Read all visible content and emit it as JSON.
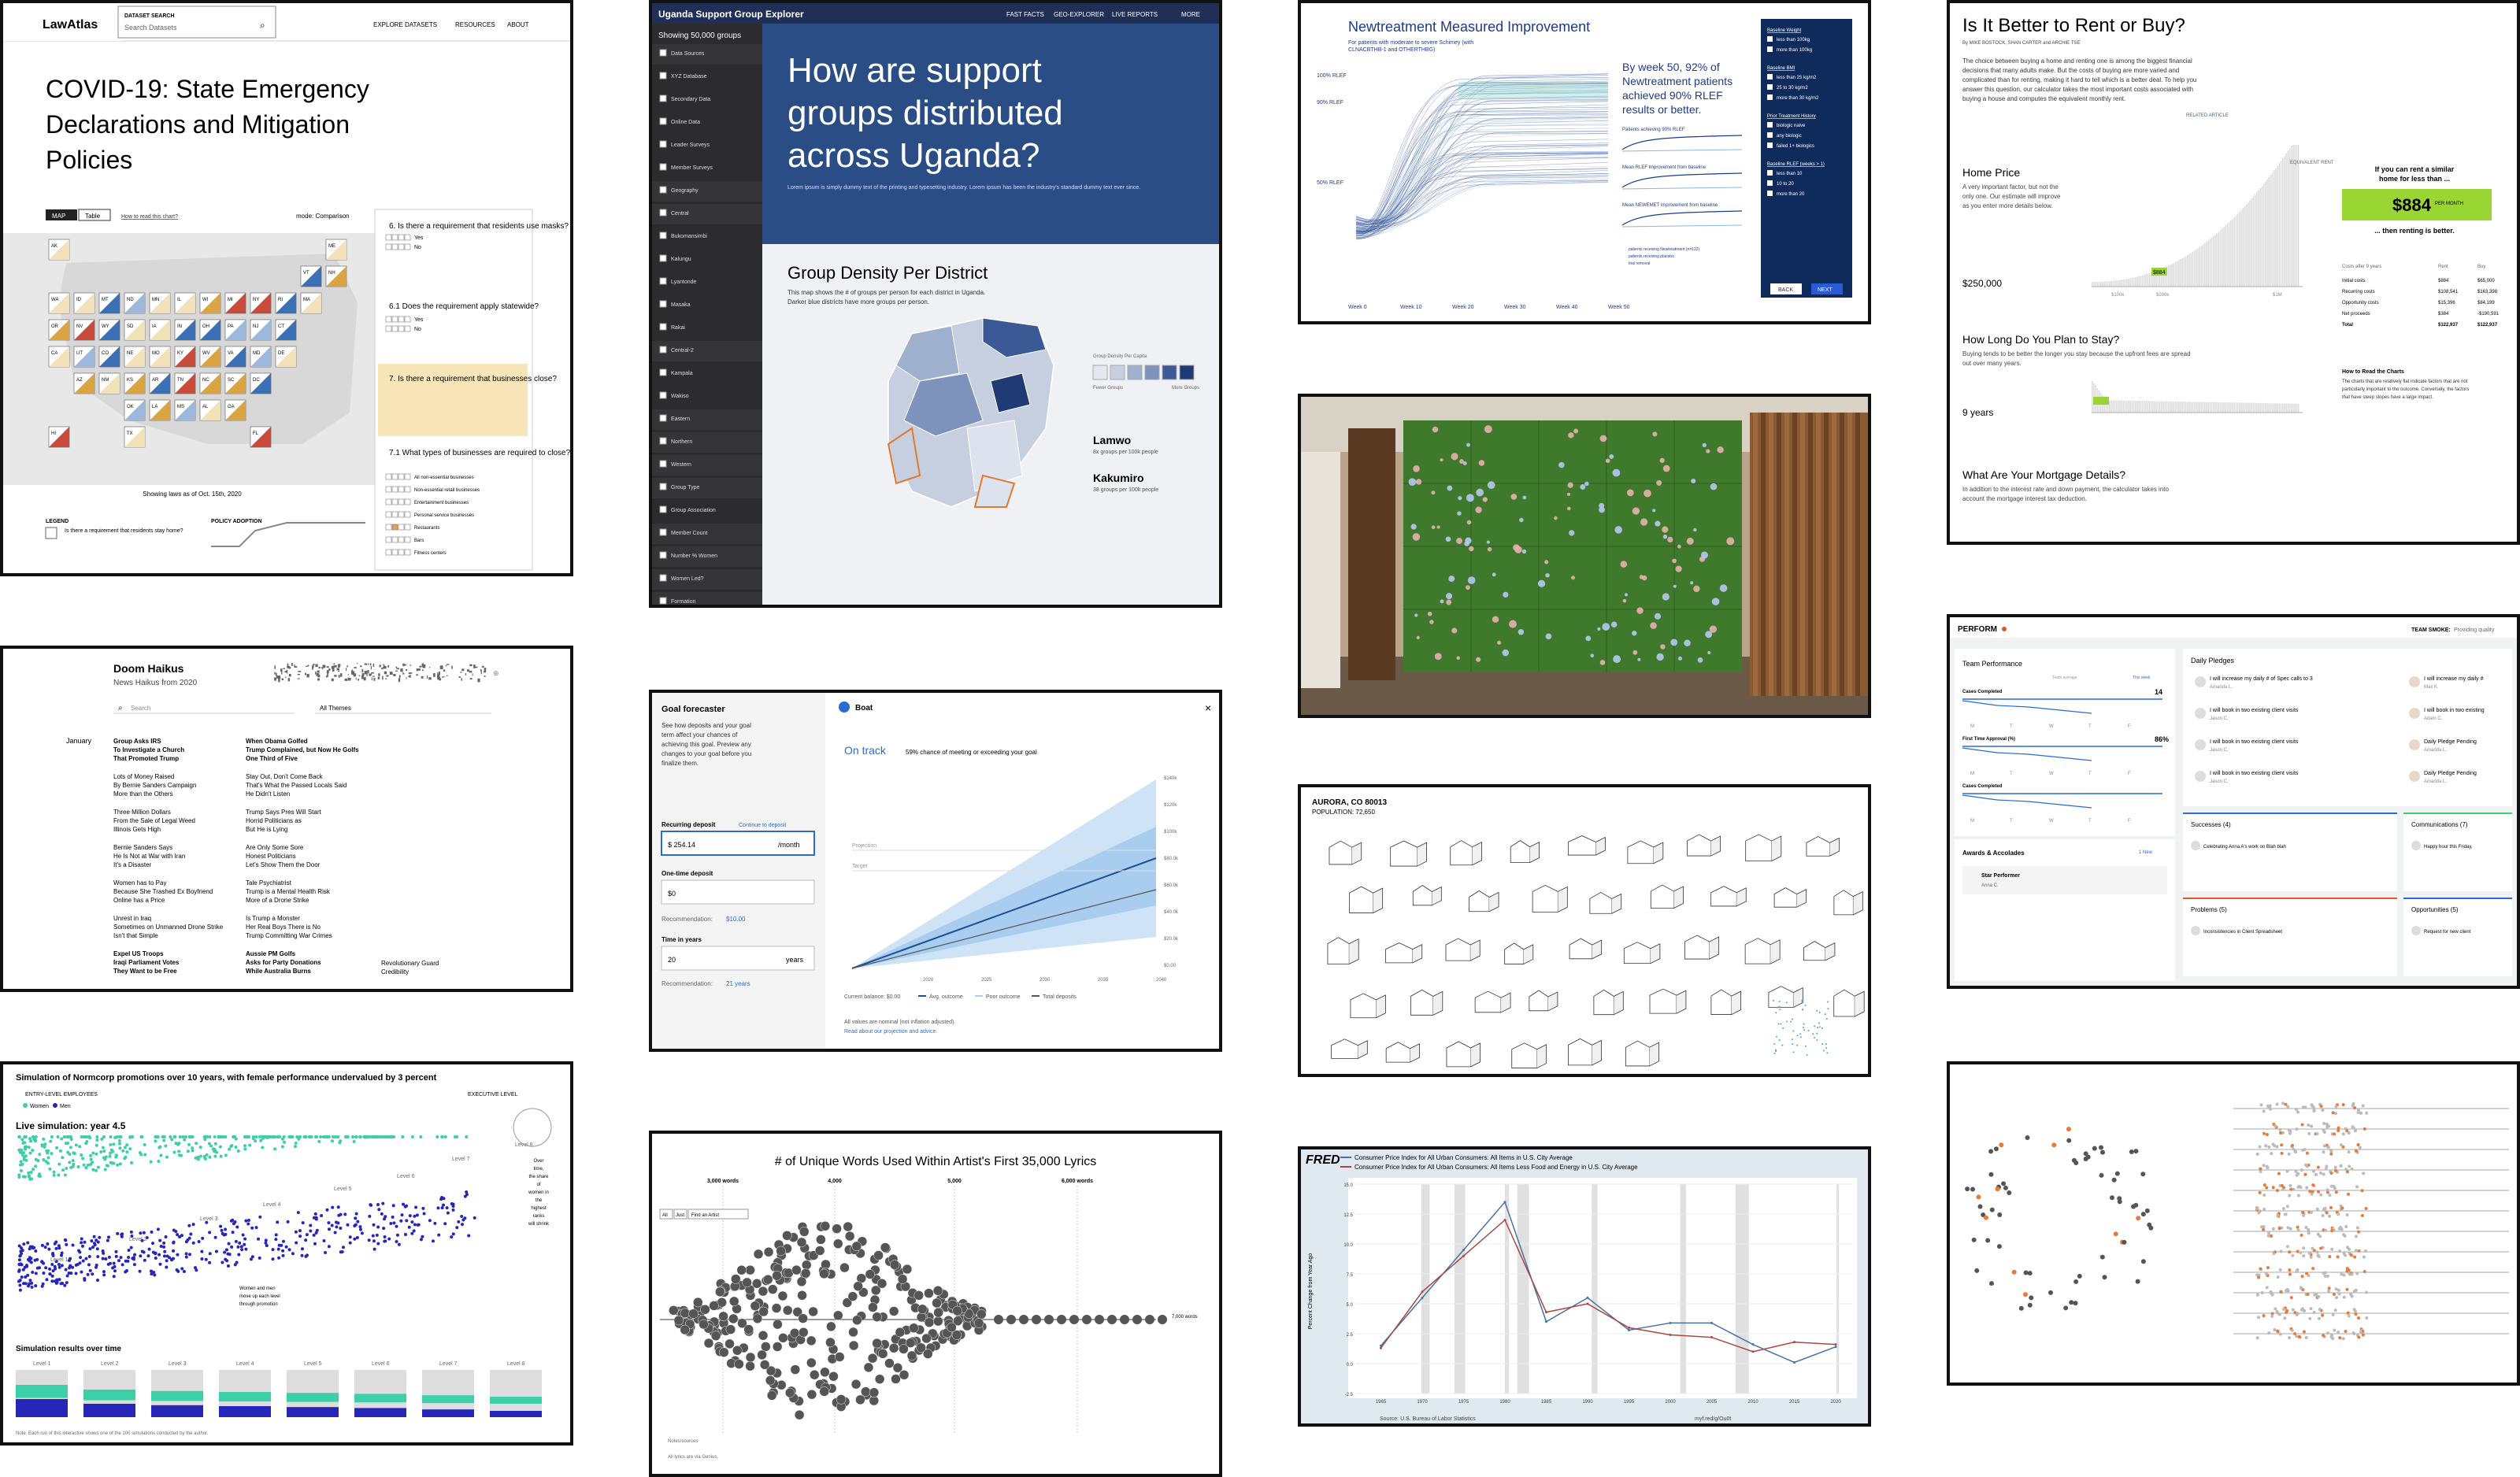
{
  "covid": {
    "logo": "LawAtlas",
    "search_label": "DATASET SEARCH",
    "search_placeholder": "Search Datasets",
    "nav": [
      "EXPLORE DATASETS",
      "RESOURCES",
      "ABOUT"
    ],
    "title": [
      "COVID-19: State Emergency",
      "Declarations and Mitigation",
      "Policies"
    ],
    "tab_map": "MAP",
    "tab_table": "Table",
    "how_to": "How to read this chart?",
    "mode": "mode: Comparison",
    "q6": "6. Is there a requirement that residents use masks?",
    "q61": "6.1 Does the requirement apply statewide?",
    "q7": "7. Is there a requirement that businesses close?",
    "q71": "7.1 What types of businesses are required to close?",
    "yes": "Yes",
    "no": "No",
    "biz": [
      "All non-essential businesses",
      "Non-essential retail businesses",
      "Entertainment businesses",
      "Personal service businesses",
      "Restaurants",
      "Bars",
      "Fitness centers"
    ],
    "showing": "Showing laws as of Oct. 15th, 2020",
    "legend": "LEGEND",
    "policy": "POLICY ADOPTION",
    "legend_text": "Is there a requirement that residents stay home?",
    "states": [
      [
        "AK",
        "",
        "",
        "",
        "",
        "",
        "",
        "",
        "",
        "",
        "",
        "ME"
      ],
      [
        "",
        "",
        "",
        "",
        "",
        "",
        "",
        "",
        "",
        "",
        "VT",
        "NH"
      ],
      [
        "WA",
        "ID",
        "MT",
        "ND",
        "MN",
        "IL",
        "WI",
        "MI",
        "NY",
        "RI",
        "MA",
        ""
      ],
      [
        "OR",
        "NV",
        "WY",
        "SD",
        "IA",
        "IN",
        "OH",
        "PA",
        "NJ",
        "CT",
        "",
        ""
      ],
      [
        "CA",
        "UT",
        "CO",
        "NE",
        "MO",
        "KY",
        "WV",
        "VA",
        "MD",
        "DE",
        "",
        ""
      ],
      [
        "",
        "AZ",
        "NM",
        "KS",
        "AR",
        "TN",
        "NC",
        "SC",
        "DC",
        "",
        "",
        ""
      ],
      [
        "",
        "",
        "",
        "OK",
        "LA",
        "MS",
        "AL",
        "GA",
        "",
        "",
        "",
        ""
      ],
      [
        "HI",
        "",
        "",
        "TX",
        "",
        "",
        "",
        "",
        "FL",
        "",
        "",
        ""
      ]
    ]
  },
  "uganda": {
    "app_title": "Uganda Support Group Explorer",
    "nav": [
      "FAST FACTS",
      "GEO-EXPLORER",
      "LIVE REPORTS",
      "MORE"
    ],
    "showing": "Showing 50,000 groups",
    "sidebar": [
      "Data Sources",
      "XYZ Database",
      "Secondary Data",
      "Online Data",
      "Leader Surveys",
      "Member Surveys",
      "Geography",
      "Central",
      "Bukomansimbi",
      "Kalungu",
      "Lyantonde",
      "Masaka",
      "Rakai",
      "Central-2",
      "Kampala",
      "Wakiso",
      "Eastern",
      "Northern",
      "Western",
      "Group Type",
      "Group Association",
      "Member Count",
      "Number % Women",
      "Women Led?",
      "Formation"
    ],
    "hero": [
      "How are support",
      "groups distributed",
      "across Uganda?"
    ],
    "hero_sub": "Lorem ipsum is simply dummy text of the printing and typesetting industry. Lorem ipsum has been the industry's standard dummy text ever since.",
    "section": "Group Density Per District",
    "section_sub": [
      "This map shows the # of groups per person for each district in Uganda.",
      "Darker blue districts have more groups per person."
    ],
    "legend_title": "Group Density Per Capita",
    "legend_lo": "Fewer Groups",
    "legend_hi": "More Groups",
    "d1": "Lamwo",
    "d1v": "8x groups per 100k people",
    "d2": "Kakumiro",
    "d2v": "38 groups per 100k people"
  },
  "treat": {
    "title": "Newtreatment Measured Improvement",
    "sub": [
      "For patients with moderate to severe Schimey (with",
      "CLNACBTHB-1 and OTHERTHBG)"
    ],
    "callout": [
      "By week 50, 92% of",
      "Newtreatment patients",
      "achieved 90% RLEF",
      "results or better."
    ],
    "yticks": [
      "100% RLEF",
      "90% RLEF",
      "50% RLEF"
    ],
    "xticks": [
      "Week 0",
      "Week 10",
      "Week 20",
      "Week 30",
      "Week 40",
      "Week 50"
    ],
    "side_groups": [
      "Baseline Weight",
      "Baseline BMI",
      "Prior Treatment History",
      "Baseline RLEF (weeks > 1)"
    ],
    "side_items": [
      "less than 100kg",
      "more than 100kg",
      "less than 25 kg/m2",
      "25 to 30 kg/m2",
      "more than 30 kg/m2",
      "biologic naive",
      "any biologic",
      "failed 1+ biologics",
      "less than 10",
      "10 to 20",
      "more than 20"
    ],
    "back": "BACK",
    "next": "NEXT",
    "mini": [
      "Patients achieving 90% RLEF",
      "Mean RLEF improvement from baseline",
      "Mean NEWEMET improvement from baseline"
    ],
    "mini_legend": [
      "patients receiving Newtreatment (n=122)",
      "patients receiving placebo",
      "trial removal"
    ]
  },
  "rent": {
    "title": "Is It Better to Rent or Buy?",
    "byline": "By MIKE BOSTOCK, SHAN CARTER and ARCHIE TSE",
    "intro": [
      "The choice between buying a home and renting one is among the biggest financial",
      "decisions that many adults make. But the costs of buying are more varied and",
      "complicated than for renting, making it hard to tell which is a better deal. To help you",
      "answer this question, our calculator takes the most important costs associated with",
      "buying a house and computes the equivalent monthly rent."
    ],
    "related": "RELATED ARTICLE",
    "home_price": "Home Price",
    "home_desc": [
      "A very important factor, but not the",
      "only one. Our estimate will improve",
      "as you enter more details below."
    ],
    "price_value": "$250,000",
    "stay_title": "How Long Do You Plan to Stay?",
    "stay_desc": [
      "Buying tends to be better the longer you stay because the upfront fees are spread",
      "out over many years."
    ],
    "stay_value": "9 years",
    "mortgage_title": "What Are Your Mortgage Details?",
    "mortgage_desc": [
      "In addition to the interest rate and down payment, the calculator takes into",
      "account the mortgage interest tax deduction."
    ],
    "equiv": "EQUIVALENT RENT",
    "rent_q": [
      "If you can rent a similar",
      "home for less than ..."
    ],
    "rent_value": "$884",
    "per_month": "PER MONTH",
    "rent_a": "... then renting is better.",
    "costs_hdr": [
      "Costs after 9 years",
      "Rent",
      "Buy"
    ],
    "costs": [
      [
        "Initial costs",
        "$884",
        "$65,000"
      ],
      [
        "Recurring costs",
        "$108,541",
        "$163,398"
      ],
      [
        "Opportunity costs",
        "$15,396",
        "$84,199"
      ],
      [
        "Net proceeds",
        "$384",
        "-$190,591"
      ],
      [
        "Total",
        "$122,937",
        "$122,937"
      ]
    ],
    "how_to": "How to Read the Charts",
    "how_to_text": [
      "The charts that are relatively flat indicate factors that are not",
      "particularly important to the outcome. Conversely, the factors",
      "that have steep slopes have a large impact."
    ],
    "ticks_price": [
      "$100k",
      "$200k",
      "$1M"
    ],
    "marker": "$884"
  },
  "wall": {
    "caption": "video wall photo"
  },
  "haiku": {
    "title": "Doom Haikus",
    "sub": "News Haikus from 2020",
    "search": "Search",
    "themes": "All Themes",
    "month": "January",
    "col1": [
      [
        "Group Asks IRS",
        "To Investigate a Church",
        "That Promoted Trump"
      ],
      [
        "Lots of Money Raised",
        "By Bernie Sanders Campaign",
        "More than the Others"
      ],
      [
        "Three Million Dollars",
        "From the Sale of Legal Weed",
        "Illinois Gets High"
      ],
      [
        "Bernie Sanders Says",
        "He Is Not at War with Iran",
        "It's a Disaster"
      ],
      [
        "Women has to Pay",
        "Because She Trashed Ex Boyfriend",
        "Online has a Price"
      ],
      [
        "Unrest in Iraq",
        "Sometimes on Unmanned Drone Strike",
        "Isn't that Simple"
      ],
      [
        "Expel US Troops",
        "Iraqi Parliament Votes",
        "They Want to be Free"
      ]
    ],
    "col2": [
      [
        "When Obama Golfed",
        "Trump Complained, but Now He Golfs",
        "One Third of Five"
      ],
      [
        "Stay Out, Don't Come Back",
        "That's What the Passed Locals Said",
        "He Didn't Listen"
      ],
      [
        "Trump Says Pres Will Start",
        "Horrid Politicians as",
        "But He is Lying"
      ],
      [
        "Are Only Some Sore",
        "Honest Politicians",
        "Let's Show Them the Door"
      ],
      [
        "Tale Psychiatrist",
        "Trump is a Mental Health Risk",
        "More of a Drone Strike"
      ],
      [
        "Is Trump a Monster",
        "Her Real Boys There is No",
        "Trump Committing War Crimes"
      ],
      [
        "Aussie PM Golfs",
        "Asks for Party Donations",
        "While Australia Burns"
      ]
    ],
    "col3": [
      [
        "Revolutionary Guard",
        "Credibility"
      ]
    ]
  },
  "goal": {
    "title": "Goal forecaster",
    "desc": [
      "See how deposits and your goal",
      "term affect your chances of",
      "achieving this goal. Preview any",
      "changes to your goal before you",
      "finalize them."
    ],
    "recurring": "Recurring deposit",
    "continue": "Continue to deposit",
    "recurring_val": "$ 254.14",
    "per_month": "/month",
    "one_time": "One-time deposit",
    "one_time_val": "$0",
    "rec1": "Recommendation: ",
    "rec1v": "$10.00",
    "time": "Time in years",
    "time_val": "20",
    "years": "years",
    "rec2": "Recommendation: ",
    "rec2v": "21 years",
    "goal_name": "Boat",
    "status": "On track",
    "status_desc": "59% chance of meeting or exceeding your goal",
    "projection": "Projection",
    "target": "Target",
    "yticks": [
      "$140k",
      "$120k",
      "$100k",
      "$80.0k",
      "$60.0k",
      "$40.0k",
      "$20.0k",
      "$0.00"
    ],
    "xticks": [
      "2020",
      "2025",
      "2030",
      "2035",
      "2040"
    ],
    "current": "Current balance: $0.00",
    "legend": [
      "Avg. outcome",
      "Poor outcome",
      "Total deposits"
    ],
    "nominal": "All values are nominal (not inflation adjusted).",
    "read": "Read about our projection and advice."
  },
  "aurora": {
    "title": "AURORA, CO 80013",
    "pop": "POPULATION: 72,650"
  },
  "perform": {
    "logo": "PERFORM",
    "team": "TEAM SMOKE:",
    "team_sub": "Providing quality",
    "team_perf": "Team Performance",
    "team_avg": "Team average",
    "you": "This week",
    "cases": "Cases Completed",
    "cases_v": "14",
    "fta": "First Time Approval (%)",
    "fta_v": "86%",
    "cases2": "Cases Completed",
    "cases2_v": "",
    "days": [
      "M",
      "T",
      "W",
      "T",
      "F"
    ],
    "daily": "Daily Pledges",
    "pledges": [
      [
        "I will increase my daily # of Spec calls to 3",
        "Amanda L."
      ],
      [
        "I will book in two existing client visits",
        "Jason C."
      ],
      [
        "I will book in two existing client visits",
        "Jason C."
      ],
      [
        "I will book in two existing client visits",
        "Jason C."
      ]
    ],
    "pledges2": [
      [
        "I will increase my daily #",
        "Max K."
      ],
      [
        "I will book in two existing",
        "Adam C."
      ],
      [
        "Daily Pledge Pending",
        "Amanda L."
      ],
      [
        "Daily Pledge Pending",
        "Amanda L."
      ]
    ],
    "awards": "Awards & Accolades",
    "star": "Star Performer",
    "star_who": "Anna C.",
    "new": "1 New",
    "successes": "Successes (4)",
    "success_item": "Celebrating Anna A's work on Blah blah",
    "problems": "Problems (5)",
    "problem_item": "Inconsistencies in Client Spreadsheet",
    "comms": "Communications (7)",
    "comm_item": "Happy hour this Friday,",
    "opps": "Opportunities (5)",
    "opp_item": "Request for new client"
  },
  "norm": {
    "title": "Simulation of Normcorp promotions over 10 years, with female performance undervalued by 3 percent",
    "entry": "ENTRY-LEVEL EMPLOYEES",
    "exec": "EXECUTIVE LEVEL",
    "women": "Women",
    "men": "Men",
    "live": "Live simulation: year 4.5",
    "levels": [
      "Level 1",
      "Level 2",
      "Level 3",
      "Level 4",
      "Level 5",
      "Level 6",
      "Level 7",
      "Level 8"
    ],
    "note": [
      "Women and men",
      "move up each level",
      "through promotion"
    ],
    "overtime": [
      "Over",
      "time,",
      "the share",
      "of",
      "women in",
      "the",
      "highest",
      "ranks",
      "will shrink"
    ],
    "results": "Simulation results over time",
    "footnote": "Note: Each run of this interactive shows one of the 100 simulations conducted by the author.",
    "women_share": [
      0.55,
      0.45,
      0.42,
      0.4,
      0.38,
      0.36,
      0.33,
      0.3
    ]
  },
  "lyrics": {
    "title": "# of Unique Words Used Within Artist's First 35,000 Lyrics",
    "ticks": [
      "3,000 words",
      "4,000",
      "5,000",
      "6,000 words"
    ],
    "all": "All",
    "just": "Just",
    "find": "Find an Artist",
    "max": "7,000 words",
    "notes": "Notes/sources",
    "genius": "All lyrics are via Genius."
  },
  "fred": {
    "logo": "FRED",
    "l1": "Consumer Price Index for All Urban Consumers: All Items in U.S. City Average",
    "l2": "Consumer Price Index for All Urban Consumers: All Items Less Food and Energy in U.S. City Average",
    "ylabel": "Percent Change from Year Ago",
    "source": "Source: U.S. Bureau of Labor Statistics",
    "link": "myf.red/g/Ou0t"
  },
  "chart_data": [
    {
      "type": "line",
      "title": "",
      "x": [
        1965,
        1970,
        1975,
        1980,
        1985,
        1990,
        1995,
        2000,
        2005,
        2010,
        2015,
        2020
      ],
      "series": [
        {
          "name": "Consumer Price Index for All Urban Consumers: All Items in U.S. City Average",
          "values": [
            1.5,
            5.5,
            9.5,
            13.5,
            3.5,
            5.5,
            2.8,
            3.4,
            3.4,
            1.6,
            0.1,
            1.4
          ]
        },
        {
          "name": "Consumer Price Index for All Urban Consumers: All Items Less Food and Energy in U.S. City Average",
          "values": [
            1.3,
            6.0,
            9.0,
            12.0,
            4.3,
            5.0,
            3.0,
            2.4,
            2.2,
            1.0,
            1.8,
            1.6
          ]
        }
      ],
      "ylabel": "Percent Change from Year Ago",
      "yticks": [
        "15.0",
        "12.5",
        "10.0",
        "7.5",
        "5.0",
        "2.5",
        "0.0",
        "-2.5"
      ],
      "xticks": [
        "1965",
        "1970",
        "1975",
        "1980",
        "1985",
        "1990",
        "1995",
        "2000",
        "2005",
        "2010",
        "2015",
        "2020"
      ],
      "ylim": [
        -2.5,
        15.0
      ]
    }
  ]
}
